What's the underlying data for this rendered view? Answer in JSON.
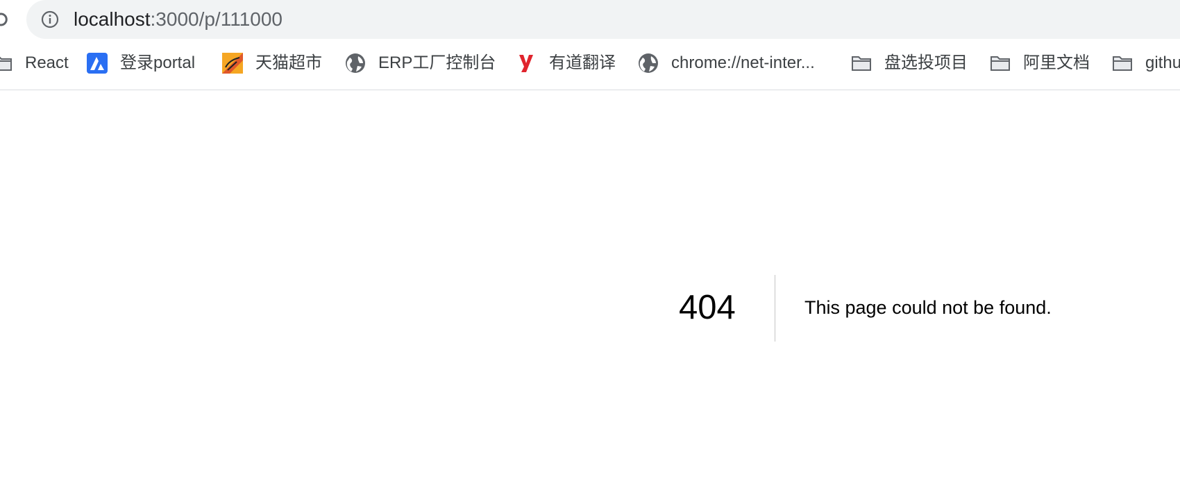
{
  "address_bar": {
    "url_host": "localhost",
    "url_rest": ":3000/p/111000"
  },
  "bookmarks": [
    {
      "label": "React",
      "icon": "folder-icon"
    },
    {
      "label": "登录portal",
      "icon": "portal-logo-icon"
    },
    {
      "label": "天猫超市",
      "icon": "tmall-logo-icon"
    },
    {
      "label": "ERP工厂控制台",
      "icon": "globe-icon"
    },
    {
      "label": "有道翻译",
      "icon": "youdao-logo-icon"
    },
    {
      "label": "chrome://net-inter...",
      "icon": "globe-icon"
    },
    {
      "label": "盘选投项目",
      "icon": "folder-icon"
    },
    {
      "label": "阿里文档",
      "icon": "folder-icon"
    },
    {
      "label": "githu",
      "icon": "folder-icon"
    }
  ],
  "error": {
    "code": "404",
    "message": "This page could not be found."
  },
  "colors": {
    "omnibox_bg": "#f1f3f4",
    "portal_blue": "#2a6ff3",
    "youdao_red": "#e0242d"
  }
}
